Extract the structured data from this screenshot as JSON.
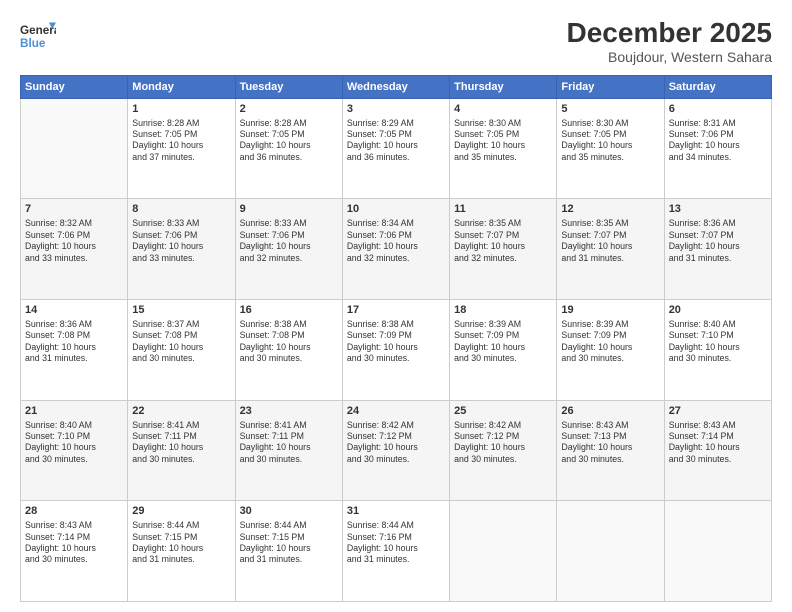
{
  "logo": {
    "text_top": "General",
    "text_bottom": "Blue"
  },
  "title": "December 2025",
  "subtitle": "Boujdour, Western Sahara",
  "days_of_week": [
    "Sunday",
    "Monday",
    "Tuesday",
    "Wednesday",
    "Thursday",
    "Friday",
    "Saturday"
  ],
  "weeks": [
    [
      {
        "day": "",
        "info": ""
      },
      {
        "day": "1",
        "info": "Sunrise: 8:28 AM\nSunset: 7:05 PM\nDaylight: 10 hours\nand 37 minutes."
      },
      {
        "day": "2",
        "info": "Sunrise: 8:28 AM\nSunset: 7:05 PM\nDaylight: 10 hours\nand 36 minutes."
      },
      {
        "day": "3",
        "info": "Sunrise: 8:29 AM\nSunset: 7:05 PM\nDaylight: 10 hours\nand 36 minutes."
      },
      {
        "day": "4",
        "info": "Sunrise: 8:30 AM\nSunset: 7:05 PM\nDaylight: 10 hours\nand 35 minutes."
      },
      {
        "day": "5",
        "info": "Sunrise: 8:30 AM\nSunset: 7:05 PM\nDaylight: 10 hours\nand 35 minutes."
      },
      {
        "day": "6",
        "info": "Sunrise: 8:31 AM\nSunset: 7:06 PM\nDaylight: 10 hours\nand 34 minutes."
      }
    ],
    [
      {
        "day": "7",
        "info": "Sunrise: 8:32 AM\nSunset: 7:06 PM\nDaylight: 10 hours\nand 33 minutes."
      },
      {
        "day": "8",
        "info": "Sunrise: 8:33 AM\nSunset: 7:06 PM\nDaylight: 10 hours\nand 33 minutes."
      },
      {
        "day": "9",
        "info": "Sunrise: 8:33 AM\nSunset: 7:06 PM\nDaylight: 10 hours\nand 32 minutes."
      },
      {
        "day": "10",
        "info": "Sunrise: 8:34 AM\nSunset: 7:06 PM\nDaylight: 10 hours\nand 32 minutes."
      },
      {
        "day": "11",
        "info": "Sunrise: 8:35 AM\nSunset: 7:07 PM\nDaylight: 10 hours\nand 32 minutes."
      },
      {
        "day": "12",
        "info": "Sunrise: 8:35 AM\nSunset: 7:07 PM\nDaylight: 10 hours\nand 31 minutes."
      },
      {
        "day": "13",
        "info": "Sunrise: 8:36 AM\nSunset: 7:07 PM\nDaylight: 10 hours\nand 31 minutes."
      }
    ],
    [
      {
        "day": "14",
        "info": "Sunrise: 8:36 AM\nSunset: 7:08 PM\nDaylight: 10 hours\nand 31 minutes."
      },
      {
        "day": "15",
        "info": "Sunrise: 8:37 AM\nSunset: 7:08 PM\nDaylight: 10 hours\nand 30 minutes."
      },
      {
        "day": "16",
        "info": "Sunrise: 8:38 AM\nSunset: 7:08 PM\nDaylight: 10 hours\nand 30 minutes."
      },
      {
        "day": "17",
        "info": "Sunrise: 8:38 AM\nSunset: 7:09 PM\nDaylight: 10 hours\nand 30 minutes."
      },
      {
        "day": "18",
        "info": "Sunrise: 8:39 AM\nSunset: 7:09 PM\nDaylight: 10 hours\nand 30 minutes."
      },
      {
        "day": "19",
        "info": "Sunrise: 8:39 AM\nSunset: 7:09 PM\nDaylight: 10 hours\nand 30 minutes."
      },
      {
        "day": "20",
        "info": "Sunrise: 8:40 AM\nSunset: 7:10 PM\nDaylight: 10 hours\nand 30 minutes."
      }
    ],
    [
      {
        "day": "21",
        "info": "Sunrise: 8:40 AM\nSunset: 7:10 PM\nDaylight: 10 hours\nand 30 minutes."
      },
      {
        "day": "22",
        "info": "Sunrise: 8:41 AM\nSunset: 7:11 PM\nDaylight: 10 hours\nand 30 minutes."
      },
      {
        "day": "23",
        "info": "Sunrise: 8:41 AM\nSunset: 7:11 PM\nDaylight: 10 hours\nand 30 minutes."
      },
      {
        "day": "24",
        "info": "Sunrise: 8:42 AM\nSunset: 7:12 PM\nDaylight: 10 hours\nand 30 minutes."
      },
      {
        "day": "25",
        "info": "Sunrise: 8:42 AM\nSunset: 7:12 PM\nDaylight: 10 hours\nand 30 minutes."
      },
      {
        "day": "26",
        "info": "Sunrise: 8:43 AM\nSunset: 7:13 PM\nDaylight: 10 hours\nand 30 minutes."
      },
      {
        "day": "27",
        "info": "Sunrise: 8:43 AM\nSunset: 7:14 PM\nDaylight: 10 hours\nand 30 minutes."
      }
    ],
    [
      {
        "day": "28",
        "info": "Sunrise: 8:43 AM\nSunset: 7:14 PM\nDaylight: 10 hours\nand 30 minutes."
      },
      {
        "day": "29",
        "info": "Sunrise: 8:44 AM\nSunset: 7:15 PM\nDaylight: 10 hours\nand 31 minutes."
      },
      {
        "day": "30",
        "info": "Sunrise: 8:44 AM\nSunset: 7:15 PM\nDaylight: 10 hours\nand 31 minutes."
      },
      {
        "day": "31",
        "info": "Sunrise: 8:44 AM\nSunset: 7:16 PM\nDaylight: 10 hours\nand 31 minutes."
      },
      {
        "day": "",
        "info": ""
      },
      {
        "day": "",
        "info": ""
      },
      {
        "day": "",
        "info": ""
      }
    ]
  ]
}
